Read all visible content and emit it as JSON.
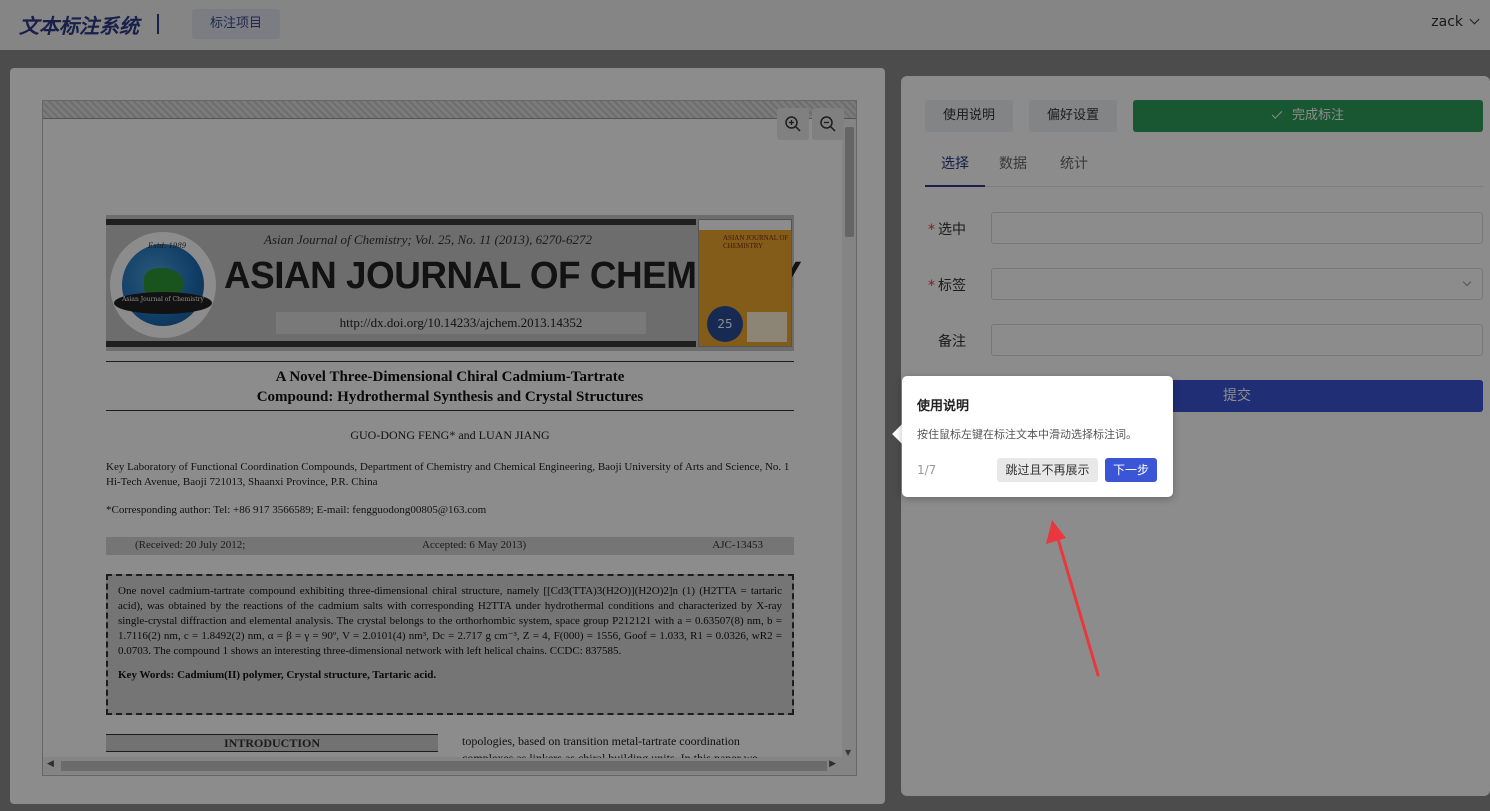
{
  "header": {
    "brand": "文本标注系统",
    "nav_item": "标注项目",
    "user": "zack"
  },
  "document": {
    "journal_citation": "Asian Journal of Chemistry;   Vol. 25, No. 11 (2013), 6270-6272",
    "journal_name": "ASIAN JOURNAL OF CHEMISTRY",
    "doi": "http://dx.doi.org/10.14233/ajchem.2013.14352",
    "estd": "Estd. 1989",
    "seal_text": "Asian Journal of Chemistry",
    "cover_title": "ASIAN JOURNAL OF CHEMISTRY",
    "cover_number": "25",
    "title_line1": "A Novel Three-Dimensional Chiral Cadmium-Tartrate",
    "title_line2": "Compound: Hydrothermal Synthesis and Crystal Structures",
    "authors": "GUO-DONG FENG* and LUAN  JIANG",
    "affiliation": "Key Laboratory of Functional Coordination Compounds, Department of Chemistry and Chemical Engineering, Baoji University of Arts and Science, No. 1 Hi-Tech Avenue, Baoji 721013, Shaanxi Province, P.R. China",
    "corresponding": "*Corresponding author: Tel: +86 917 3566589; E-mail: fengguodong00805@163.com",
    "received": "(Received: 20 July 2012;",
    "accepted": "Accepted: 6 May 2013)",
    "article_id": "AJC-13453",
    "abstract": "One novel cadmium-tartrate compound exhibiting three-dimensional chiral structure, namely [[Cd3(TTA)3(H2O)](H2O)2]n (1) (H2TTA = tartaric acid), was obtained by the reactions of the cadmium salts with corresponding H2TTA under hydrothermal conditions and characterized by X-ray single-crystal diffraction and elemental analysis. The crystal belongs to the orthorhombic system, space group P212121 with a = 0.63507(8) nm, b = 1.7116(2) nm, c = 1.8492(2) nm, α = β = γ = 90º, V = 2.0101(4) nm³, Dc = 2.717 g cm⁻³, Z = 4, F(000) = 1556, Goof = 1.033, R1 = 0.0326, wR2 = 0.0703. The compound 1 shows an interesting three-dimensional network with left helical chains. CCDC: 837585.",
    "keywords": "Key Words: Cadmium(II) polymer, Crystal structure, Tartaric acid.",
    "intro_heading": "INTRODUCTION",
    "intro_text": "topologies, based on transition metal-tartrate coordination",
    "intro_text2": "complexes as linkers as chiral building units. In this paper we"
  },
  "toolbar": {
    "usage_label": "使用说明",
    "pref_label": "偏好设置",
    "done_label": "完成标注"
  },
  "tabs": [
    "选择",
    "数据",
    "统计"
  ],
  "form": {
    "selected_label": "选中",
    "tag_label": "标签",
    "note_label": "备注",
    "submit_label": "提交"
  },
  "popover": {
    "title": "使用说明",
    "description": "按住鼠标左键在标注文本中滑动选择标注词。",
    "step": "1/7",
    "skip_label": "跳过且不再展示",
    "next_label": "下一步"
  },
  "colors": {
    "accent": "#2b3a87",
    "success": "#2e9e5b",
    "primary": "#3a55d6",
    "pointer": "#e8383d"
  }
}
